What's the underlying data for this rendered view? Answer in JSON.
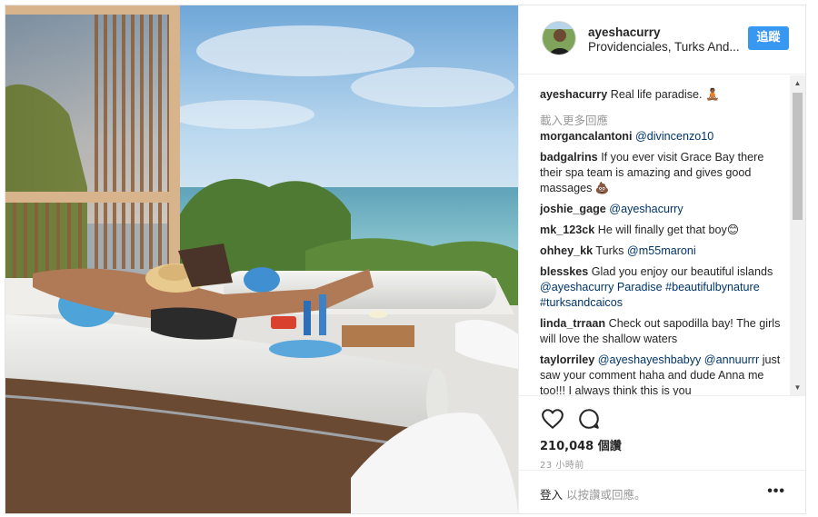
{
  "post": {
    "username": "ayeshacurry",
    "location": "Providenciales, Turks And...",
    "follow_label": "追蹤"
  },
  "caption": {
    "user": "ayeshacurry",
    "text": "Real life paradise. 🧘🏾"
  },
  "load_more": "載入更多回應",
  "comments": [
    {
      "user": "morgancalantoni",
      "text": "",
      "mention": "@divincenzo10",
      "after": ""
    },
    {
      "user": "badgalrins",
      "text": "If you ever visit Grace Bay there their spa team is amazing and gives good massages 💩",
      "mention": "",
      "after": ""
    },
    {
      "user": "joshie_gage",
      "text": "",
      "mention": "@ayeshacurry",
      "after": ""
    },
    {
      "user": "mk_123ck",
      "text": "He will finally get that boy😊",
      "mention": "",
      "after": ""
    },
    {
      "user": "ohhey_kk",
      "text": "Turks",
      "mention": "@m55maroni",
      "after": ""
    },
    {
      "user": "blesskes",
      "text": "Glad you enjoy our beautiful islands",
      "mention": "@ayeshacurry",
      "after": "Paradise #beautifulbynature #turksandcaicos"
    },
    {
      "user": "linda_trraan",
      "text": "Check out sapodilla bay! The girls will love the shallow waters",
      "mention": "",
      "after": ""
    },
    {
      "user": "taylorriley",
      "text": "",
      "mention": "@ayeshayeshbabyy @annuurrr",
      "after": "just saw your comment haha and dude Anna me too!!! I always think this is you"
    }
  ],
  "likes": "210,048 個讚",
  "time_ago": "23 小時前",
  "footer": {
    "login": "登入",
    "rest": "以按讚或回應。"
  },
  "icons": [
    "heart-icon",
    "comment-icon",
    "more-options-icon",
    "scroll-up-arrow-icon",
    "scroll-down-arrow-icon"
  ],
  "colors": {
    "follow_button": "#3897f0",
    "mention": "#003569",
    "muted_text": "#999999"
  }
}
